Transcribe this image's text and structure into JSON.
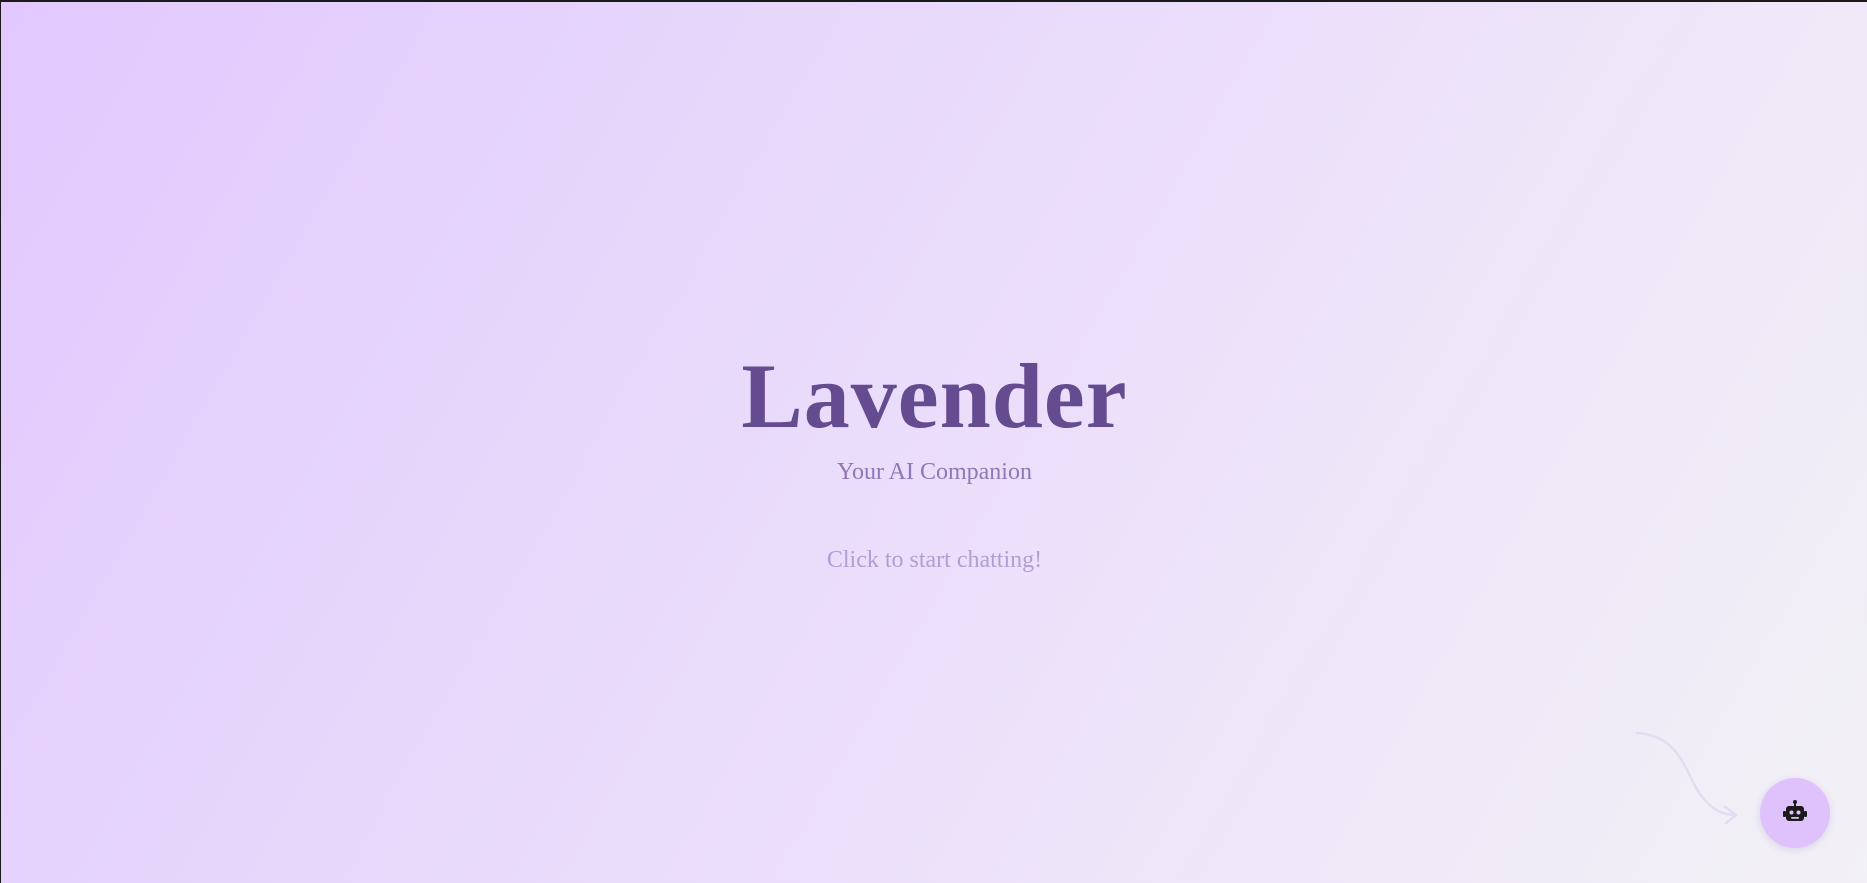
{
  "hero": {
    "title": "Lavender",
    "subtitle": "Your AI Companion",
    "cta": "Click to start chatting!"
  },
  "chat_button": {
    "icon": "robot-icon"
  },
  "colors": {
    "title": "#654b8f",
    "subtitle": "#8f78b3",
    "cta": "#b29ed0",
    "fab_background": "#dfc2fc",
    "gradient_start": "#e2c8ff",
    "gradient_end": "#f2f1f6"
  }
}
